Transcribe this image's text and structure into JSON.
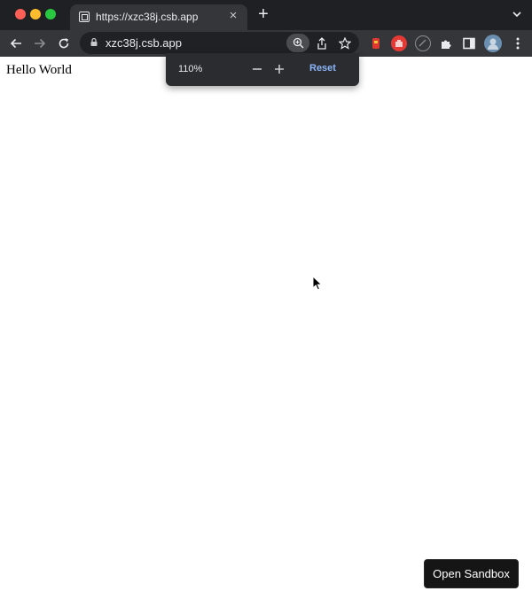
{
  "browser": {
    "tab": {
      "title": "https://xzc38j.csb.app",
      "favicon": "square-favicon-icon"
    },
    "url": "xzc38j.csb.app",
    "icons": {
      "back": "back-arrow-icon",
      "forward": "forward-arrow-icon",
      "reload": "reload-icon",
      "zoom": "zoom-icon",
      "share": "share-icon",
      "bookmark": "star-icon",
      "extensions": "puzzle-icon",
      "sidepanel": "side-panel-icon",
      "menu": "kebab-menu-icon"
    }
  },
  "zoom_popup": {
    "level": "110%",
    "reset_label": "Reset"
  },
  "page": {
    "text": "Hello World",
    "open_sandbox_label": "Open Sandbox"
  },
  "colors": {
    "titlebar": "#1f2023",
    "toolbar": "#35363a",
    "omnibox": "#202124",
    "reset_link": "#8ab4f8",
    "sandbox_button": "#151515"
  }
}
